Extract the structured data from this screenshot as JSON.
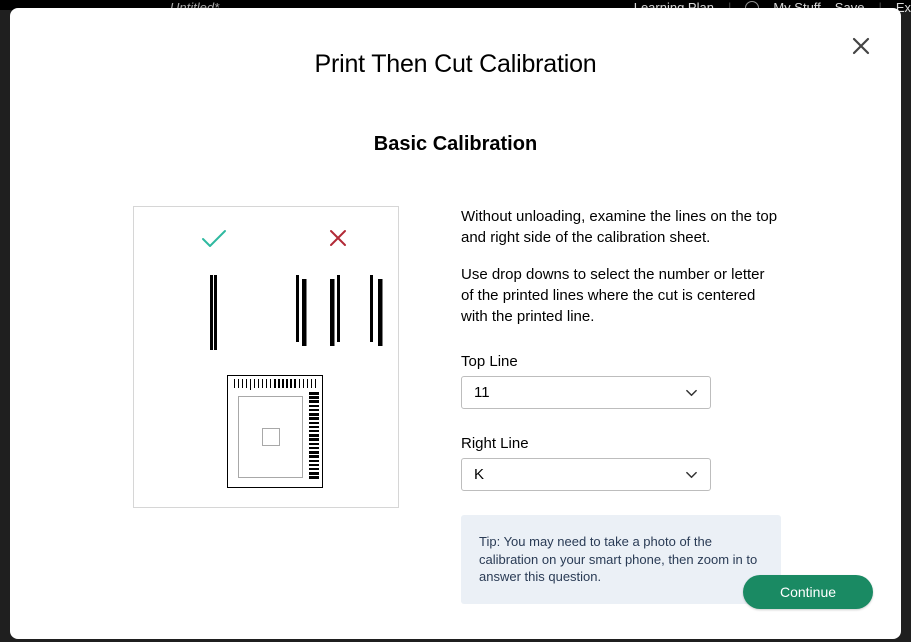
{
  "backgroundBar": {
    "docName": "Untitled*",
    "learning": "Learning Plan",
    "myStuff": "My Stuff",
    "save": "Save",
    "export": "Ex"
  },
  "modal": {
    "title": "Print Then Cut Calibration",
    "subheading": "Basic Calibration",
    "paragraph1": "Without unloading, examine the lines on the top and right side of the calibration sheet.",
    "paragraph2": "Use drop downs to select the number or letter of the printed lines where the cut is centered with the printed line.",
    "topLine": {
      "label": "Top Line",
      "value": "11"
    },
    "rightLine": {
      "label": "Right Line",
      "value": "K"
    },
    "tip": "Tip: You may need to take a photo of the calibration on your smart phone, then zoom in to answer this question.",
    "continueLabel": "Continue"
  },
  "colors": {
    "checkGreen": "#2fb9a0",
    "xRed": "#b22a37",
    "continueGreen": "#1a8a63"
  }
}
